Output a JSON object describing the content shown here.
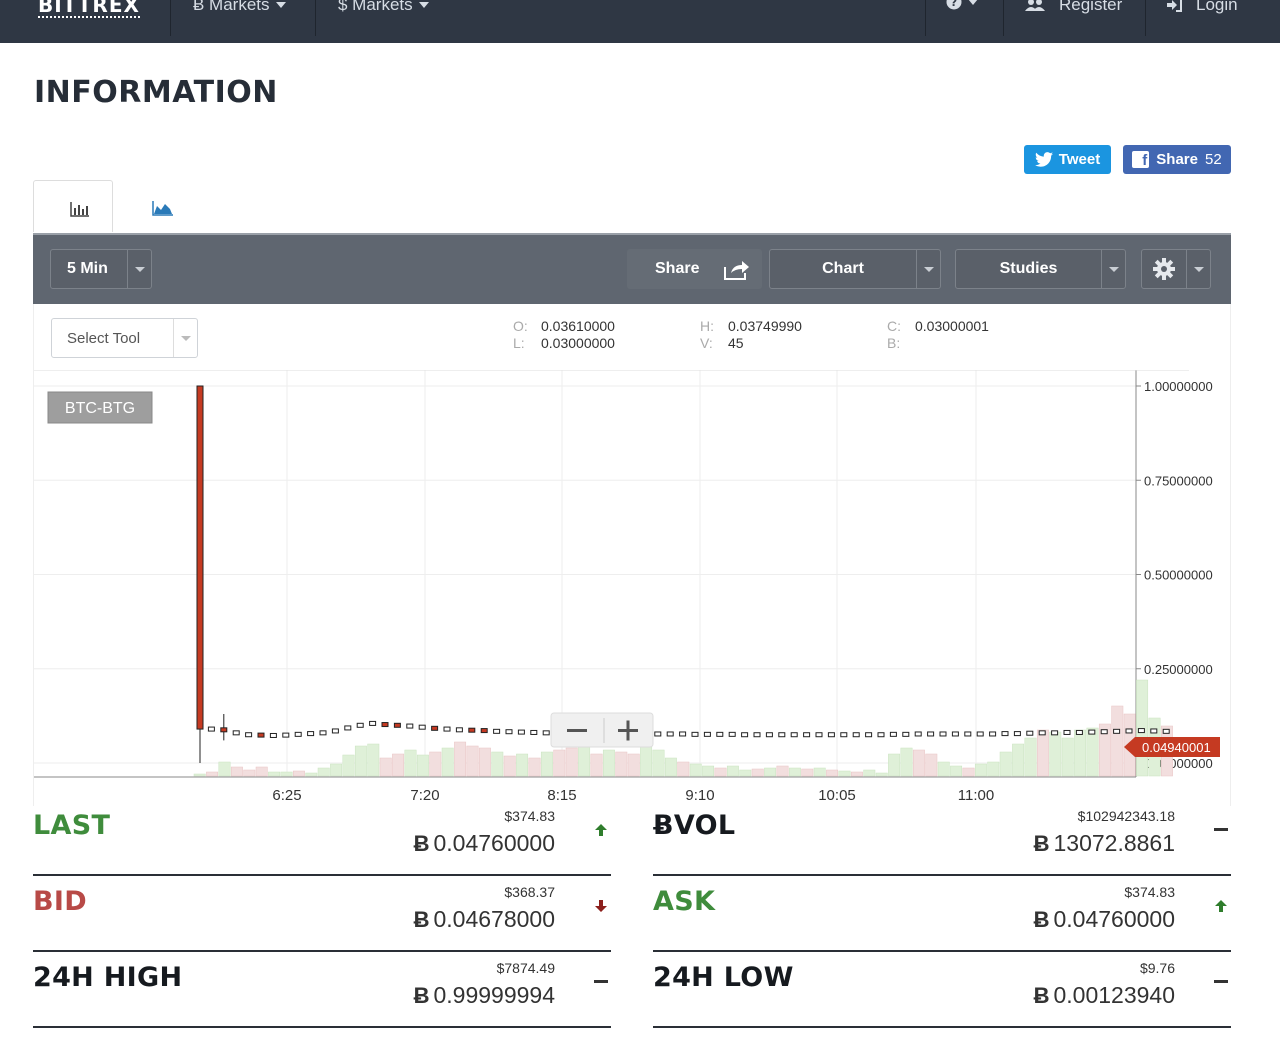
{
  "nav": {
    "brand": "BITTREX",
    "btc_markets": "Ƀ Markets",
    "usd_markets": "$ Markets",
    "help_icon": "question-icon",
    "register": "Register",
    "login": "Login"
  },
  "page_title": "INFORMATION",
  "social": {
    "tweet_label": "Tweet",
    "share_label": "Share",
    "share_count": "52"
  },
  "toolbar": {
    "interval": "5 Min",
    "share": "Share",
    "chart": "Chart",
    "studies": "Studies"
  },
  "subbar": {
    "select_tool": "Select Tool",
    "o_key": "O:",
    "o_val": "0.03610000",
    "l_key": "L:",
    "l_val": "0.03000000",
    "h_key": "H:",
    "h_val": "0.03749990",
    "v_key": "V:",
    "v_val": "45",
    "c_key": "C:",
    "c_val": "0.03000001",
    "b_key": "B:",
    "b_val": ""
  },
  "chart_data": {
    "type": "candlestick",
    "symbol": "BTC-BTG",
    "x_tick_labels": [
      "6:25",
      "7:20",
      "8:15",
      "9:10",
      "10:05",
      "11:00"
    ],
    "y_tick_labels": [
      "1.00000000",
      "0.75000000",
      "0.50000000",
      "0.25000000",
      "0.00000000"
    ],
    "ylim": [
      0,
      1
    ],
    "last_price_label": "0.04940001",
    "last_price": 0.0494,
    "grid": true,
    "colors": {
      "down": "#c53a22",
      "up": "#ffffff",
      "vol_up": "#dff0d8",
      "vol_down": "#f2dede",
      "price_tag": "#c53a22"
    }
  },
  "stats": {
    "last": {
      "label": "LAST",
      "usd": "$374.83",
      "btc": "0.04760000"
    },
    "bvol": {
      "label": "ɃVOL",
      "usd": "$102942343.18",
      "btc": "13072.8861"
    },
    "bid": {
      "label": "BID",
      "usd": "$368.37",
      "btc": "0.04678000"
    },
    "ask": {
      "label": "ASK",
      "usd": "$374.83",
      "btc": "0.04760000"
    },
    "high": {
      "label": "24H HIGH",
      "usd": "$7874.49",
      "btc": "0.99999994"
    },
    "low": {
      "label": "24H LOW",
      "usd": "$9.76",
      "btc": "0.00123940"
    },
    "btc_symbol": "Ƀ"
  }
}
